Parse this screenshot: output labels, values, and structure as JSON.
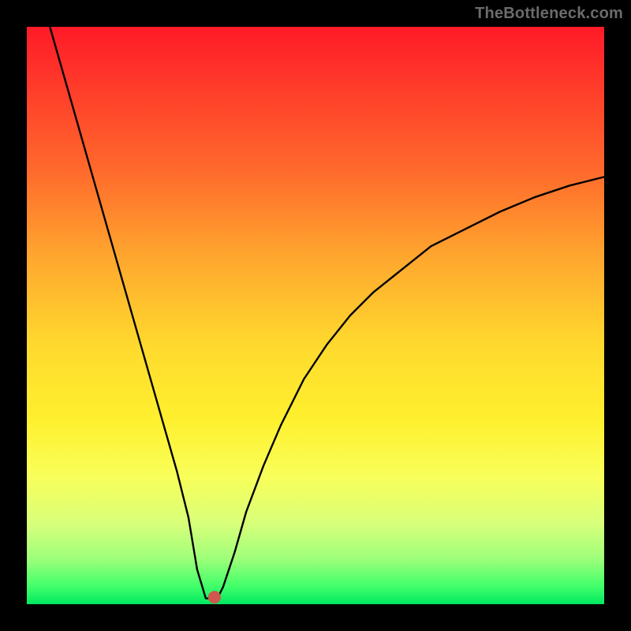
{
  "watermark": "TheBottleneck.com",
  "chart_data": {
    "type": "line",
    "title": "",
    "xlabel": "",
    "ylabel": "",
    "xlim": [
      0,
      100
    ],
    "ylim": [
      0,
      100
    ],
    "grid": false,
    "legend": false,
    "curve": {
      "x": [
        4,
        6,
        8,
        10,
        12,
        14,
        16,
        18,
        20,
        22,
        24,
        26,
        28,
        29.5,
        31,
        32,
        33,
        34,
        36,
        38,
        41,
        44,
        48,
        52,
        56,
        60,
        65,
        70,
        76,
        82,
        88,
        94,
        100
      ],
      "y": [
        100,
        93,
        86,
        79,
        72,
        65,
        58,
        51,
        44,
        37,
        30,
        23,
        15,
        6,
        1,
        1,
        1,
        3,
        9,
        16,
        24,
        31,
        39,
        45,
        50,
        54,
        58,
        62,
        65,
        68,
        70.5,
        72.5,
        74
      ]
    },
    "marker": {
      "x": 32.5,
      "y": 1.2,
      "color": "#cf574c",
      "r": 1.1
    },
    "background_gradient": [
      {
        "stop": 0.0,
        "color": "#ff1a28"
      },
      {
        "stop": 0.55,
        "color": "#ffd92e"
      },
      {
        "stop": 0.97,
        "color": "#3fff6a"
      },
      {
        "stop": 1.0,
        "color": "#00e860"
      }
    ]
  }
}
